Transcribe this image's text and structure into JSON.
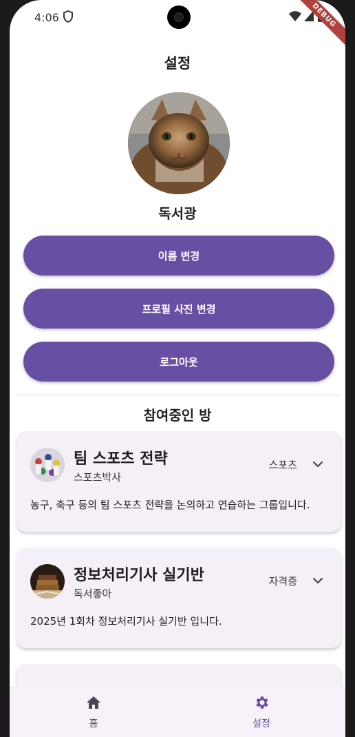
{
  "status_bar": {
    "time": "4:06",
    "debug_label": "DEBUG"
  },
  "header": {
    "title": "설정"
  },
  "profile": {
    "username": "독서광",
    "avatar_icon": "cat-photo"
  },
  "actions": {
    "change_name": "이름 변경",
    "change_photo": "프로필 사진 변경",
    "logout": "로그아웃"
  },
  "rooms_section": {
    "title": "참여중인 방"
  },
  "rooms": [
    {
      "title": "팀 스포츠 전략",
      "owner": "스포츠박사",
      "category": "스포츠",
      "description": "농구, 축구 등의 팀 스포츠 전략을 논의하고 연습하는 그룹입니다."
    },
    {
      "title": "정보처리기사 실기반",
      "owner": "독서좋아",
      "category": "자격증",
      "description": "2025년 1회차 정보처리기사 실기반 입니다."
    }
  ],
  "bottom_nav": {
    "home_label": "홈",
    "settings_label": "설정",
    "active": "settings"
  },
  "colors": {
    "primary": "#6750a4",
    "card_bg": "#f5eff7",
    "nav_bg": "#f7f1f9",
    "debug": "#b0413e"
  }
}
